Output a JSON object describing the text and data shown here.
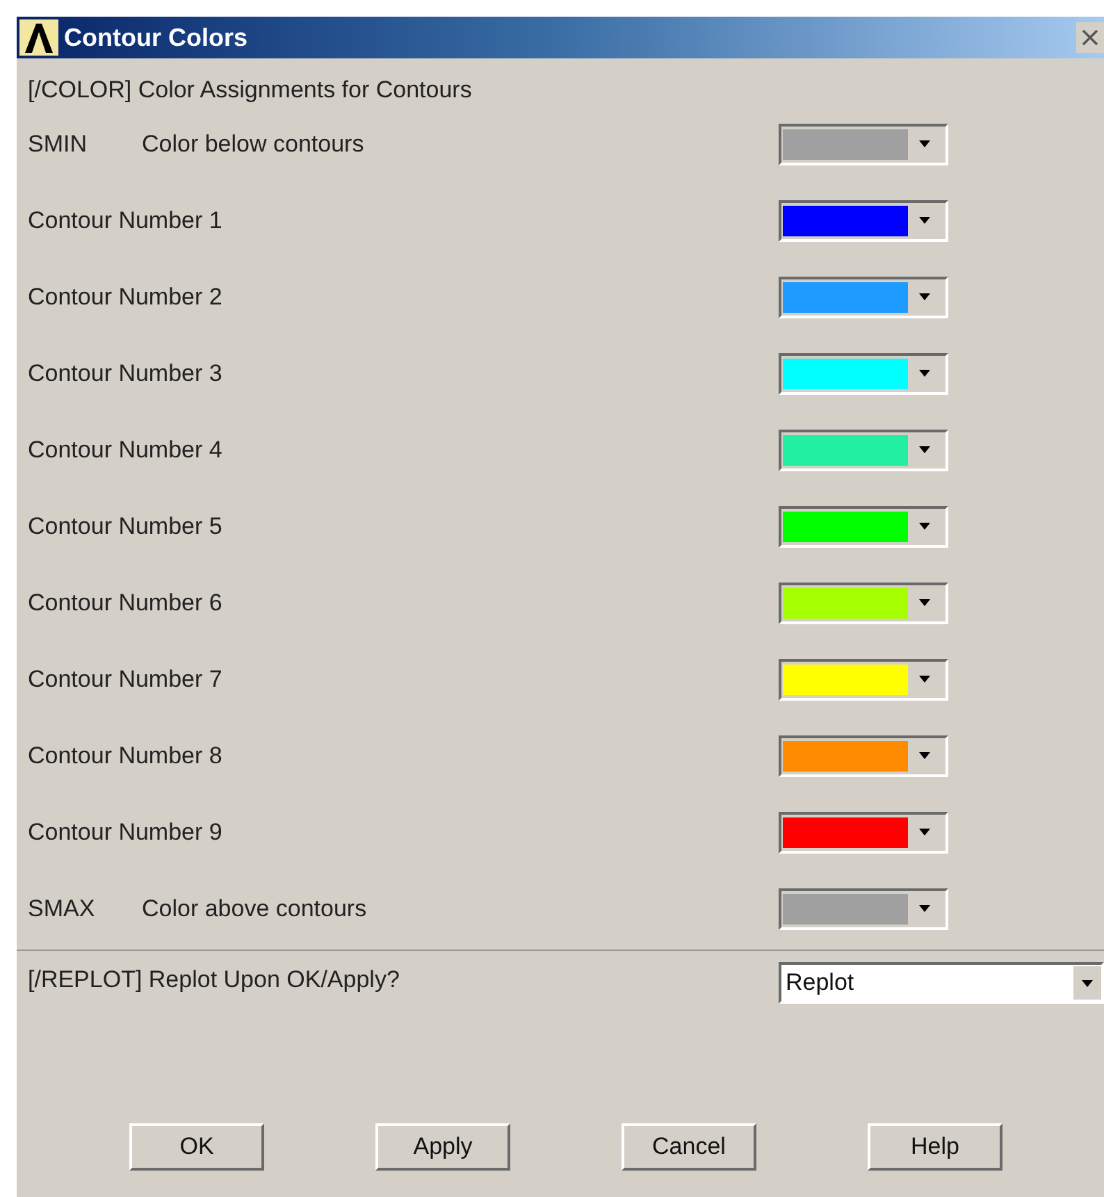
{
  "window": {
    "title": "Contour Colors"
  },
  "header": "[/COLOR]  Color Assignments for Contours",
  "rows": [
    {
      "kind": "limit",
      "code": "SMIN",
      "label": "Color below contours",
      "color": "#a0a0a0"
    },
    {
      "kind": "contour",
      "label": "Contour Number 1",
      "color": "#0000ff"
    },
    {
      "kind": "contour",
      "label": "Contour Number 2",
      "color": "#1e9bff"
    },
    {
      "kind": "contour",
      "label": "Contour Number 3",
      "color": "#00ffff"
    },
    {
      "kind": "contour",
      "label": "Contour Number 4",
      "color": "#22f0a0"
    },
    {
      "kind": "contour",
      "label": "Contour Number 5",
      "color": "#00ff00"
    },
    {
      "kind": "contour",
      "label": "Contour Number 6",
      "color": "#a6ff00"
    },
    {
      "kind": "contour",
      "label": "Contour Number 7",
      "color": "#ffff00"
    },
    {
      "kind": "contour",
      "label": "Contour Number 8",
      "color": "#ff8c00"
    },
    {
      "kind": "contour",
      "label": "Contour Number 9",
      "color": "#ff0000"
    },
    {
      "kind": "limit",
      "code": "SMAX",
      "label": "Color above contours",
      "color": "#a0a0a0"
    }
  ],
  "replot": {
    "label": "[/REPLOT]  Replot Upon OK/Apply?",
    "value": "Replot"
  },
  "buttons": [
    "OK",
    "Apply",
    "Cancel",
    "Help"
  ]
}
